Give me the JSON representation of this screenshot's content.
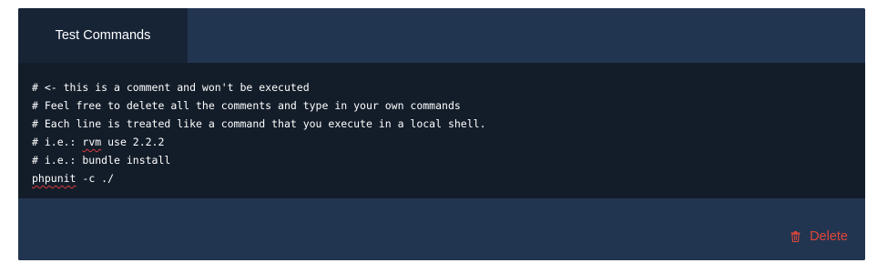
{
  "tabs": [
    {
      "label": "Test Commands"
    }
  ],
  "editor": {
    "lines": [
      "# <- this is a comment and won't be executed",
      "# Feel free to delete all the comments and type in your own commands",
      "# Each line is treated like a command that you execute in a local shell.",
      "# i.e.: rvm use 2.2.2",
      "# i.e.: bundle install",
      "phpunit -c ./"
    ]
  },
  "footer": {
    "delete_label": "Delete",
    "delete_icon": "trash-icon"
  },
  "colors": {
    "panel_bg": "#223550",
    "editor_bg": "#131d2a",
    "tab_active_bg": "#172436",
    "danger": "#e0463a"
  }
}
